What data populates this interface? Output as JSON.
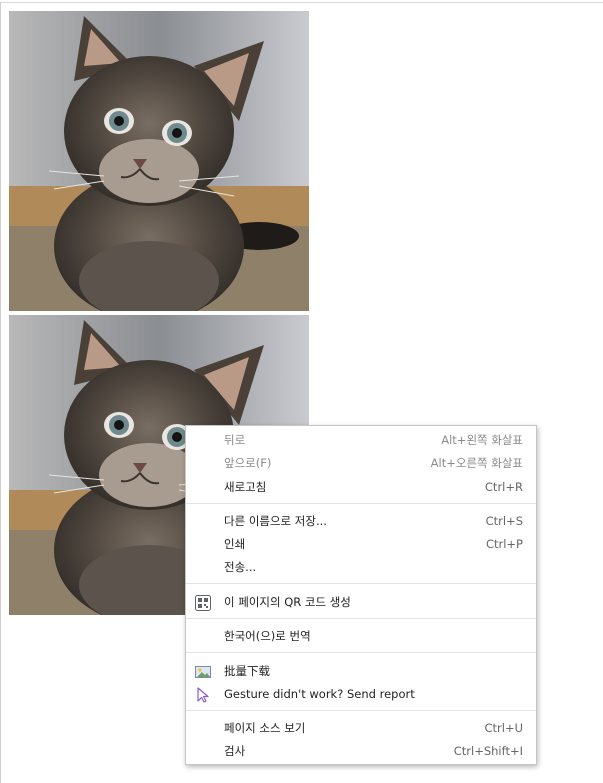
{
  "menu": {
    "back": {
      "label": "뒤로",
      "shortcut": "Alt+왼쪽 화살표"
    },
    "forward": {
      "label": "앞으로(F)",
      "shortcut": "Alt+오른쪽 화살표"
    },
    "reload": {
      "label": "새로고침",
      "shortcut": "Ctrl+R"
    },
    "save_as": {
      "label": "다른 이름으로 저장...",
      "shortcut": "Ctrl+S"
    },
    "print": {
      "label": "인쇄",
      "shortcut": "Ctrl+P"
    },
    "send": {
      "label": "전송..."
    },
    "qr": {
      "label": "이 페이지의 QR 코드 생성",
      "icon": "qr-code-icon"
    },
    "translate": {
      "label": "한국어(으)로 번역"
    },
    "batch_download": {
      "label": "批量下载",
      "icon": "image-icon"
    },
    "gesture_report": {
      "label": "Gesture didn't work? Send report",
      "icon": "cursor-arrow-icon"
    },
    "view_source": {
      "label": "페이지 소스 보기",
      "shortcut": "Ctrl+U"
    },
    "inspect": {
      "label": "검사",
      "shortcut": "Ctrl+Shift+I"
    }
  },
  "colors": {
    "menu_background": "#ffffff",
    "menu_border": "#c6c6c6",
    "text": "#222222",
    "disabled_text": "#8a8a8a",
    "separator": "#e3e3e3"
  }
}
